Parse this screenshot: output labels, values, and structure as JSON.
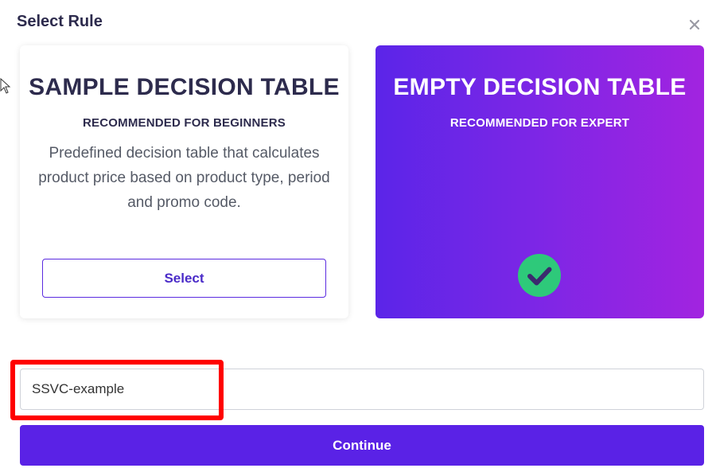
{
  "dialog": {
    "title": "Select Rule",
    "close_icon": "close-icon"
  },
  "cards": {
    "sample": {
      "title": "SAMPLE DECISION TABLE",
      "subtitle": "RECOMMENDED FOR BEGINNERS",
      "description": "Predefined decision table that calculates product price based on product type, period and promo code.",
      "select_label": "Select",
      "selected": false
    },
    "empty": {
      "title": "EMPTY DECISION TABLE",
      "subtitle": "RECOMMENDED FOR EXPERT",
      "selected": true,
      "selected_icon": "check-circle-icon"
    }
  },
  "name_input": {
    "value": "SSVC-example"
  },
  "continue_label": "Continue",
  "colors": {
    "accent": "#5a22e6",
    "gradient_start": "#5b25e8",
    "gradient_end": "#a224e0",
    "check_green": "#2ec97a",
    "highlight": "#ff0000"
  }
}
